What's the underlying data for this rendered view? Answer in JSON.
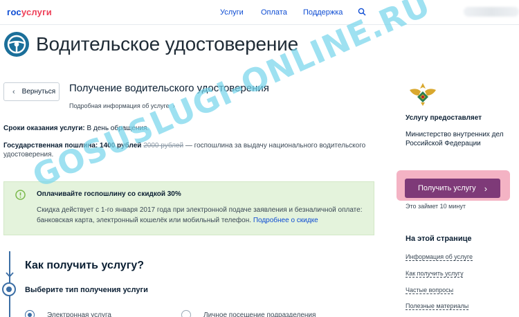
{
  "header": {
    "logo_part1": "гос",
    "logo_part2": "услуги",
    "nav": [
      {
        "label": "Услуги"
      },
      {
        "label": "Оплата"
      },
      {
        "label": "Поддержка"
      }
    ],
    "search_icon": "search-icon"
  },
  "page": {
    "title": "Водительское удостоверение",
    "back_label": "Вернуться",
    "service_title": "Получение водительского удостоверения",
    "details_link": "Подробная информация об услуге"
  },
  "terms": {
    "label": "Сроки оказания услуги:",
    "value": "В день обращения."
  },
  "fee": {
    "label": "Государственная пошлина: 1400 рублей",
    "old_price": "2000 рублей",
    "description": "— госпошлина за выдачу национального водительского удостоверения."
  },
  "notice": {
    "icon": "info-icon",
    "title": "Оплачивайте госпошлину со скидкой 30%",
    "text": "Скидка действует с 1-го января 2017 года при электронной подаче заявления и безналичной оплате: банковская карта, электронный кошелёк или мобильный телефон.",
    "link": "Подробнее о скидке",
    "colors": {
      "background": "#e4f3dc",
      "icon": "#79b84a"
    }
  },
  "how": {
    "title": "Как получить услугу?",
    "step_title": "Выберите тип получения услуги",
    "options": [
      {
        "label": "Электронная услуга",
        "selected": true
      },
      {
        "label": "Личное посещение подразделения",
        "selected": false
      }
    ]
  },
  "sidebar": {
    "provider_label": "Услугу предоставляет",
    "provider_name": "Министерство внутренних дел Российской Федерации",
    "cta_label": "Получить услугу",
    "cta_note": "Это займет 10 минут",
    "onpage_title": "На этой странице",
    "onpage_links": [
      {
        "label": "Информация об услуге"
      },
      {
        "label": "Как получить услугу"
      },
      {
        "label": "Частые вопросы"
      },
      {
        "label": "Полезные материалы"
      }
    ],
    "colors": {
      "cta": "#7e3a78",
      "cta_highlight": "#f4b3c4"
    }
  },
  "watermark": "GOSUSLUGI-ONLINE.RU",
  "colors": {
    "link": "#0d4cd3",
    "brand_red": "#ee3f58",
    "timeline": "#3b6ea5"
  }
}
